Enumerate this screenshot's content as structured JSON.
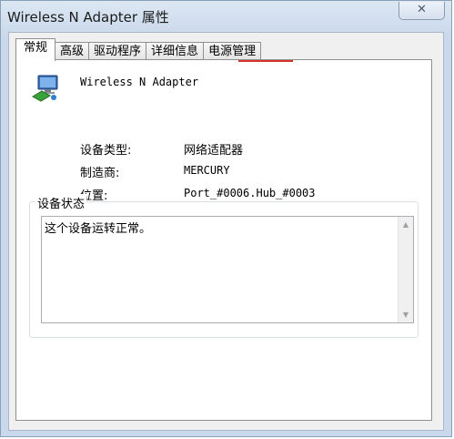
{
  "window": {
    "title": "Wireless N Adapter 属性",
    "close_symbol": "✕"
  },
  "tabs": [
    {
      "label": "常规",
      "active": true
    },
    {
      "label": "高级",
      "active": false
    },
    {
      "label": "驱动程序",
      "active": false
    },
    {
      "label": "详细信息",
      "active": false
    },
    {
      "label": "电源管理",
      "active": false
    }
  ],
  "device": {
    "icon": "network-adapter-icon",
    "name": "Wireless N Adapter"
  },
  "properties": {
    "type_label": "设备类型:",
    "type_value": "网络适配器",
    "maker_label": "制造商:",
    "maker_value": "MERCURY",
    "location_label": "位置:",
    "location_value": "Port_#0006.Hub_#0003"
  },
  "status": {
    "group_label": "设备状态",
    "text": "这个设备运转正常。",
    "scroll_up": "▲",
    "scroll_down": "▼"
  },
  "colors": {
    "highlight_underline": "#d9342b"
  }
}
